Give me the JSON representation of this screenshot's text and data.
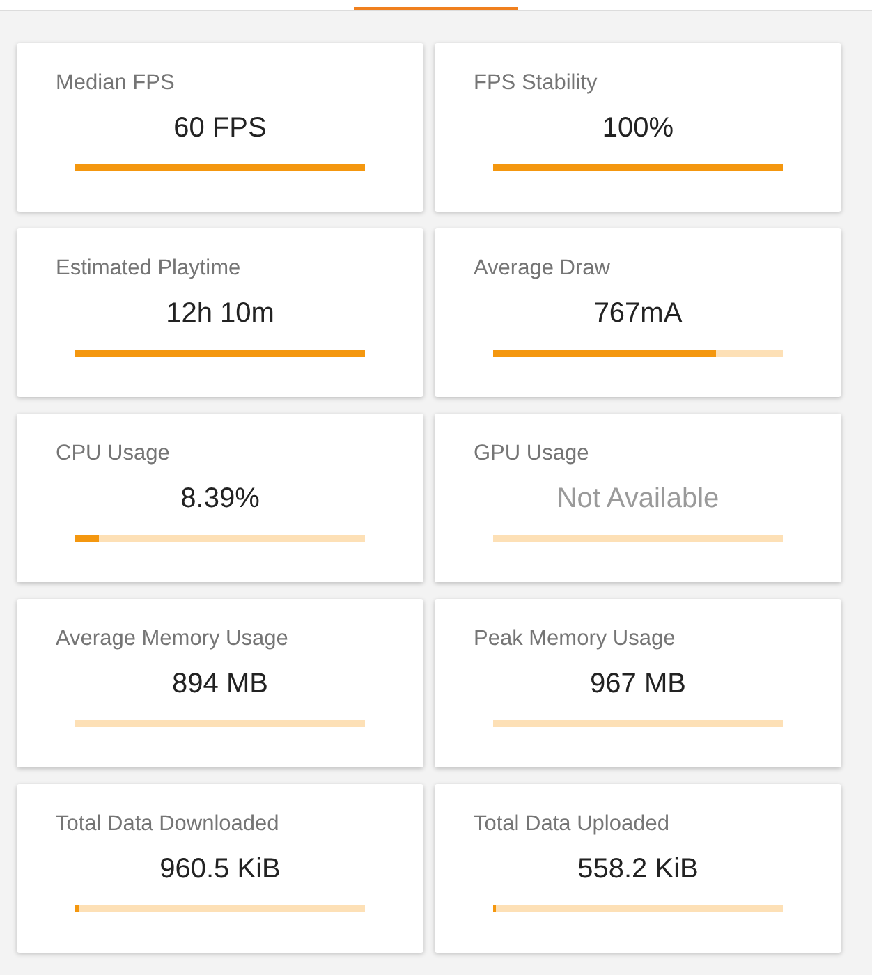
{
  "tab_bar": {
    "tabs": [
      {
        "selected": false
      },
      {
        "selected": false
      },
      {
        "selected": true
      },
      {
        "selected": false
      },
      {
        "selected": false
      }
    ]
  },
  "metrics": [
    {
      "label": "Median FPS",
      "value": "60 FPS",
      "available": true,
      "level": 1
    },
    {
      "label": "FPS Stability",
      "value": "100%",
      "available": true,
      "level": 1
    },
    {
      "label": "Estimated Playtime",
      "value": "12h 10m",
      "available": true,
      "level": 1
    },
    {
      "label": "Average Draw",
      "value": "767mA",
      "available": true,
      "level": 0.77
    },
    {
      "label": "CPU Usage",
      "value": "8.39%",
      "available": true,
      "level": 0.0839
    },
    {
      "label": "GPU Usage",
      "value": "Not Available",
      "available": false
    },
    {
      "label": "Average Memory Usage",
      "value": "894 MB",
      "available": true
    },
    {
      "label": "Peak Memory Usage",
      "value": "967 MB",
      "available": true
    },
    {
      "label": "Total Data Downloaded",
      "value": "960.5 KiB",
      "available": true,
      "level": 0.015
    },
    {
      "label": "Total Data Uploaded",
      "value": "558.2 KiB",
      "available": true,
      "level": 0.01
    }
  ]
}
